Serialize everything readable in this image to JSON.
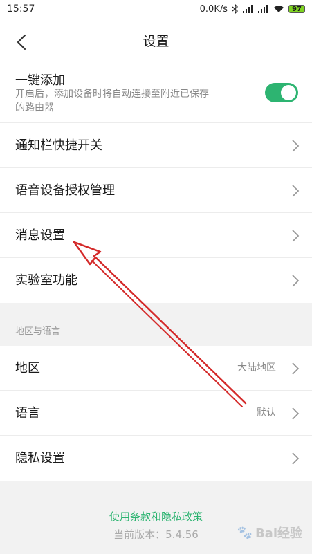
{
  "status_bar": {
    "time": "15:57",
    "network_speed": "0.0K/s",
    "battery_level": "97",
    "icons": [
      "bluetooth-icon",
      "signal-icon",
      "signal-icon",
      "wifi-icon",
      "battery-icon"
    ]
  },
  "header": {
    "title": "设置",
    "back_icon": "chevron-left-icon"
  },
  "settings": {
    "one_key_add": {
      "title": "一键添加",
      "description": "开启后，添加设备时将自动连接至附近已保存的路由器",
      "enabled": true
    },
    "items": [
      {
        "label": "通知栏快捷开关"
      },
      {
        "label": "语音设备授权管理"
      },
      {
        "label": "消息设置"
      },
      {
        "label": "实验室功能"
      }
    ]
  },
  "region_section": {
    "header": "地区与语言",
    "items": [
      {
        "label": "地区",
        "value": "大陆地区"
      },
      {
        "label": "语言",
        "value": "默认"
      },
      {
        "label": "隐私设置"
      }
    ]
  },
  "footer": {
    "terms_link": "使用条款和隐私政策",
    "version": "当前版本：5.4.56"
  },
  "watermark": "Bai经验",
  "colors": {
    "accent": "#2db471",
    "annotation": "#d42a2a"
  }
}
